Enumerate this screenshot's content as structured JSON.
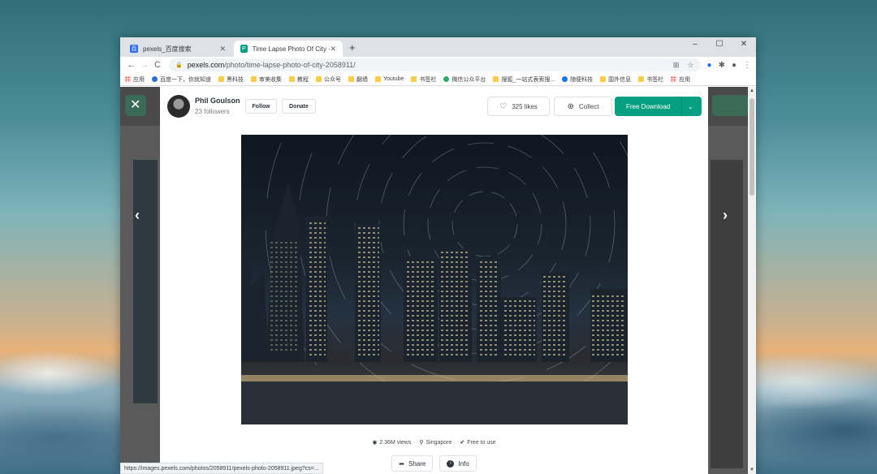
{
  "browser": {
    "tabs": [
      {
        "title": "pexels_百度搜索",
        "active": false
      },
      {
        "title": "Time Lapse Photo Of City - Fre",
        "active": true
      }
    ],
    "new_tab": "+",
    "window_controls": {
      "minimize": "–",
      "maximize": "☐",
      "close": "✕"
    },
    "nav": {
      "back": "←",
      "forward": "→",
      "reload": "C"
    },
    "url_host": "pexels.com",
    "url_path": "/photo/time-lapse-photo-of-city-2058911/",
    "status_url": "https://images.pexels.com/photos/2058911/pexels-photo-2058911.jpeg?cs=..."
  },
  "bookmarks": [
    {
      "label": "应用",
      "icon": "apps"
    },
    {
      "label": "百度一下，你就知道",
      "icon": "baidu"
    },
    {
      "label": "黑科技",
      "icon": "folder"
    },
    {
      "label": "审美收集",
      "icon": "folder"
    },
    {
      "label": "教程",
      "icon": "folder"
    },
    {
      "label": "公众号",
      "icon": "folder"
    },
    {
      "label": "翻墙",
      "icon": "folder"
    },
    {
      "label": "Youtube",
      "icon": "folder"
    },
    {
      "label": "书签栏",
      "icon": "folder"
    },
    {
      "label": "微信公众平台",
      "icon": "green"
    },
    {
      "label": "搜狐_一站式表索搜...",
      "icon": "folder"
    },
    {
      "label": "随便科技",
      "icon": "s"
    },
    {
      "label": "国外信息",
      "icon": "folder"
    },
    {
      "label": "书签栏",
      "icon": "folder"
    },
    {
      "label": "应用",
      "icon": "apps"
    }
  ],
  "modal": {
    "author": {
      "name": "Phil Goulson",
      "followers": "23 followers"
    },
    "follow_label": "Follow",
    "donate_label": "Donate",
    "likes_label": "325 likes",
    "collect_label": "Collect",
    "download_label": "Free Download",
    "stats": {
      "views": "2.36M views",
      "location": "Singapore",
      "license": "Free to use"
    },
    "share_label": "Share",
    "info_label": "Info"
  },
  "colors": {
    "accent": "#05a081"
  }
}
